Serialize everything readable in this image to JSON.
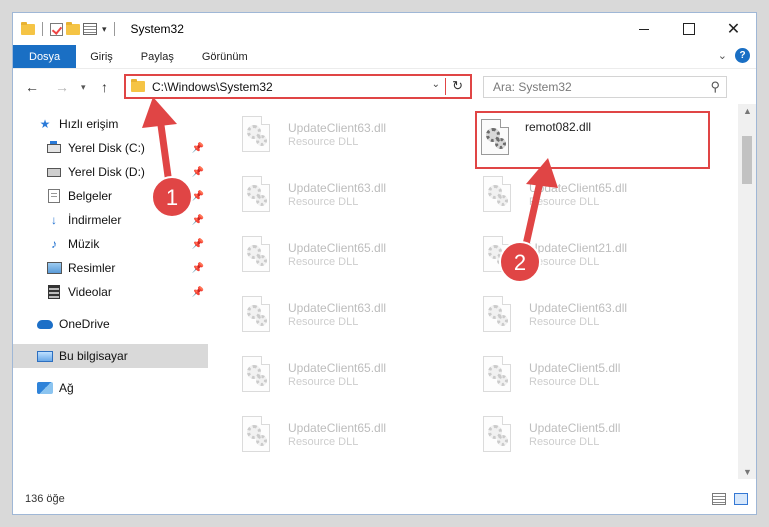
{
  "window": {
    "title": "System32"
  },
  "ribbon": {
    "tabs": [
      "Dosya",
      "Giriş",
      "Paylaş",
      "Görünüm"
    ]
  },
  "address": {
    "path": "C:\\Windows\\System32"
  },
  "search": {
    "placeholder": "Ara: System32"
  },
  "nav": {
    "items": [
      {
        "label": "Hızlı erişim",
        "icon": "star-icon",
        "pinned": false
      },
      {
        "label": "Yerel Disk (C:)",
        "icon": "drive-icon",
        "pinned": true
      },
      {
        "label": "Yerel Disk (D:)",
        "icon": "drive-icon",
        "pinned": true
      },
      {
        "label": "Belgeler",
        "icon": "documents-icon",
        "pinned": true
      },
      {
        "label": "İndirmeler",
        "icon": "download-icon",
        "pinned": true
      },
      {
        "label": "Müzik",
        "icon": "music-icon",
        "pinned": true
      },
      {
        "label": "Resimler",
        "icon": "pictures-icon",
        "pinned": true
      },
      {
        "label": "Videolar",
        "icon": "videos-icon",
        "pinned": true
      },
      {
        "label": "OneDrive",
        "icon": "cloud-icon",
        "pinned": false
      },
      {
        "label": "Bu bilgisayar",
        "icon": "computer-icon",
        "pinned": false,
        "selected": true
      },
      {
        "label": "Ağ",
        "icon": "network-icon",
        "pinned": false
      }
    ]
  },
  "files": {
    "left": [
      {
        "name": "UpdateClient63.dll",
        "type": "Resource DLL"
      },
      {
        "name": "UpdateClient63.dll",
        "type": "Resource DLL"
      },
      {
        "name": "UpdateClient65.dll",
        "type": "Resource DLL"
      },
      {
        "name": "UpdateClient63.dll",
        "type": "Resource DLL"
      },
      {
        "name": "UpdateClient65.dll",
        "type": "Resource DLL"
      },
      {
        "name": "UpdateClient65.dll",
        "type": "Resource DLL"
      }
    ],
    "right": [
      {
        "name": "remot082.dll",
        "type": "",
        "highlighted": true
      },
      {
        "name": "UpdateClient65.dll",
        "type": "Resource DLL"
      },
      {
        "name": "UpdateClient21.dll",
        "type": "Resource DLL"
      },
      {
        "name": "UpdateClient63.dll",
        "type": "Resource DLL"
      },
      {
        "name": "UpdateClient5.dll",
        "type": "Resource DLL"
      },
      {
        "name": "UpdateClient5.dll",
        "type": "Resource DLL"
      }
    ]
  },
  "status": {
    "count": "136 öğe"
  },
  "annotations": {
    "step1": "1",
    "step2": "2",
    "color": "#e04545"
  }
}
